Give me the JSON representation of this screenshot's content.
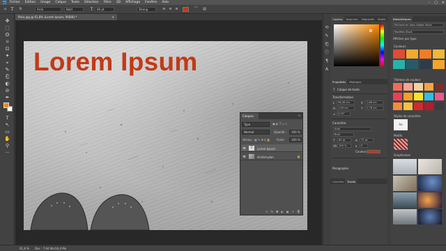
{
  "menubar": {
    "app_badge": "Ps",
    "items": [
      "Fichier",
      "Edition",
      "Image",
      "Calque",
      "Texte",
      "Sélection",
      "Filtre",
      "3D",
      "Affichage",
      "Fenêtre",
      "Aide"
    ],
    "window_buttons": [
      "–",
      "▢",
      "✕"
    ]
  },
  "options": {
    "font_family": "Arial",
    "font_style": "Bold",
    "font_size": "60 pt",
    "antialias": "Strong",
    "text_color": "#c0391a"
  },
  "tools": [
    "✥",
    "⬚",
    "ʘ",
    "⌑",
    "⊡",
    "✦",
    "⌖",
    "✎",
    "⎗",
    "◐",
    "⊘",
    "✒",
    "T",
    "↖",
    "▭",
    "✋",
    "⚲",
    "···"
  ],
  "document": {
    "tab_title": "Pleix.jpg @ 61,8% (Lorem Ipsum, RVB/8) *",
    "close": "✕",
    "headline_text": "Lorem Ipsum",
    "headline_color": "#c23a17"
  },
  "layers_panel": {
    "tab": "Calques",
    "search": "Type",
    "blend_mode": "Normal",
    "opacity_label": "Opacité :",
    "opacity": "100 %",
    "lock_label": "Verrou :",
    "fill_label": "Fond :",
    "fill": "100 %",
    "layers": [
      {
        "name": "Lorem Ipsum",
        "kind": "text"
      },
      {
        "name": "Arrière-plan",
        "kind": "pixel"
      }
    ],
    "footer_icons": [
      "⊝",
      "fx",
      "◘",
      "◐",
      "▣",
      "+",
      "🗑"
    ]
  },
  "color_panel": {
    "tabs": [
      "Couleur",
      "Nuancier",
      "Dégradés",
      "Motifs"
    ]
  },
  "properties_panel": {
    "tabs": [
      "Propriétés",
      "Réglages"
    ],
    "layer_type": "Calque de texte",
    "transform_title": "Transformation",
    "w": "96,49 cm",
    "h": "1,49 cm",
    "x": "1,66 cm",
    "y": "1,78 cm",
    "angle": "0,00°",
    "char_title": "Caractère",
    "font": "Arial",
    "style": "Bold",
    "size": "60 pt",
    "leading": "72 pt",
    "tracking": "100 %",
    "baseline": "0",
    "color_label": "Couleur",
    "paragraph_title": "Paragraphe"
  },
  "bottom_tabs": [
    "Couches",
    "Tracés"
  ],
  "library_panel": {
    "tab": "Bibliothèques",
    "search": "Rechercher dans Adobe Stock",
    "library_name": "Modèles Stock",
    "view": "Afficher par type",
    "colors_title": "Couleurs",
    "themes_title": "Thèmes de couleur",
    "char_styles_title": "Styles de caractère",
    "char_style_sample": "Aa",
    "patterns_title": "Motifs",
    "graphics_title": "Graphismes",
    "items_count": "26 élé",
    "colors": [
      "#e14a35",
      "#f3a92d",
      "#f07d26",
      "#f0b73a",
      "#26b2a7",
      "#265a6e",
      "#2b3d4a",
      "#f2a52c"
    ],
    "themes": [
      [
        "#f26a5a",
        "#f6a48f",
        "#f5d2a2",
        "#f2a547",
        "#7c2e2a"
      ],
      [
        "#f03d56",
        "#f4a023",
        "#f6e42a",
        "#2ebfe6",
        "#e95a90"
      ],
      [
        "#f28c3a",
        "#f3c245",
        "#d42a2a",
        "#b21c2c",
        "#3c3c3c"
      ]
    ]
  },
  "status": {
    "zoom": "61,8 %",
    "doc_info": "Doc : 7,94 Mo/16,4 Mo"
  }
}
